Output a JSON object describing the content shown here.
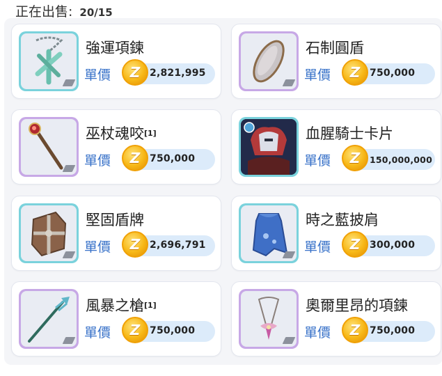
{
  "header": {
    "label": "正在出售:",
    "count": "20/15"
  },
  "price_label": "單價",
  "coin_glyph": "Z",
  "items": [
    {
      "name": "強運項鍊",
      "suffix": "",
      "price": "2,821,995",
      "frame": "teal",
      "icon": "necklace-cross-icon"
    },
    {
      "name": "石制圓盾",
      "suffix": "",
      "price": "750,000",
      "frame": "purple",
      "icon": "round-shield-icon"
    },
    {
      "name": "巫杖魂咬",
      "suffix": "[1]",
      "price": "750,000",
      "frame": "purple",
      "icon": "staff-icon"
    },
    {
      "name": "血腥騎士卡片",
      "suffix": "",
      "price": "150,000,000",
      "frame": "teal",
      "icon": "knight-card-icon"
    },
    {
      "name": "堅固盾牌",
      "suffix": "",
      "price": "2,696,791",
      "frame": "teal",
      "icon": "wooden-shield-icon"
    },
    {
      "name": "時之藍披肩",
      "suffix": "",
      "price": "300,000",
      "frame": "teal",
      "icon": "blue-cape-icon"
    },
    {
      "name": "風暴之槍",
      "suffix": "[1]",
      "price": "750,000",
      "frame": "purple",
      "icon": "spear-icon"
    },
    {
      "name": "奧爾里昂的項鍊",
      "suffix": "",
      "price": "750,000",
      "frame": "purple",
      "icon": "pendant-necklace-icon"
    }
  ]
}
